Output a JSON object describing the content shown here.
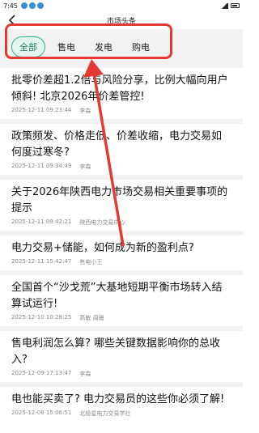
{
  "status_bar": {
    "time": "7:45"
  },
  "nav": {
    "title": "市场头条"
  },
  "tabs": [
    {
      "label": "全部"
    },
    {
      "label": "售电"
    },
    {
      "label": "发电"
    },
    {
      "label": "购电"
    }
  ],
  "articles": [
    {
      "title": "批零价差超1.2倍与风险分享，比例大幅向用户倾斜! 北京2026年价差管控!",
      "date": "2025-12-11 09:23:44",
      "author": "李森"
    },
    {
      "title": "政策频发、价格走低、价差收缩，电力交易如何度过寒冬?",
      "date": "2025-12-11 09:34:49",
      "author": "李森"
    },
    {
      "title": "关于2026年陕西电力市场交易相关重要事项的提示",
      "date": "2025-12-11 09:42:21",
      "author": "陕西电力交易中心"
    },
    {
      "title": "电力交易+储能，如何成为新的盈利点?",
      "date": "2025-12-11 15:42:47",
      "author": "售电小王"
    },
    {
      "title": "全国首个“沙戈荒”大基地短期平衡市场转入结算试运行!",
      "date": "2025-12-10 10:28:25",
      "author": "高敏 周珊"
    },
    {
      "title": "售电利润怎么算? 哪些关键数据影响你的总收入?",
      "date": "2025-12-09 17:13:47",
      "author": "李森"
    },
    {
      "title": "电也能买卖了? 电力交易员的这些你必须了解!",
      "date": "2025-12-08 15:06:51",
      "author": "北极星电力交易学社"
    }
  ]
}
